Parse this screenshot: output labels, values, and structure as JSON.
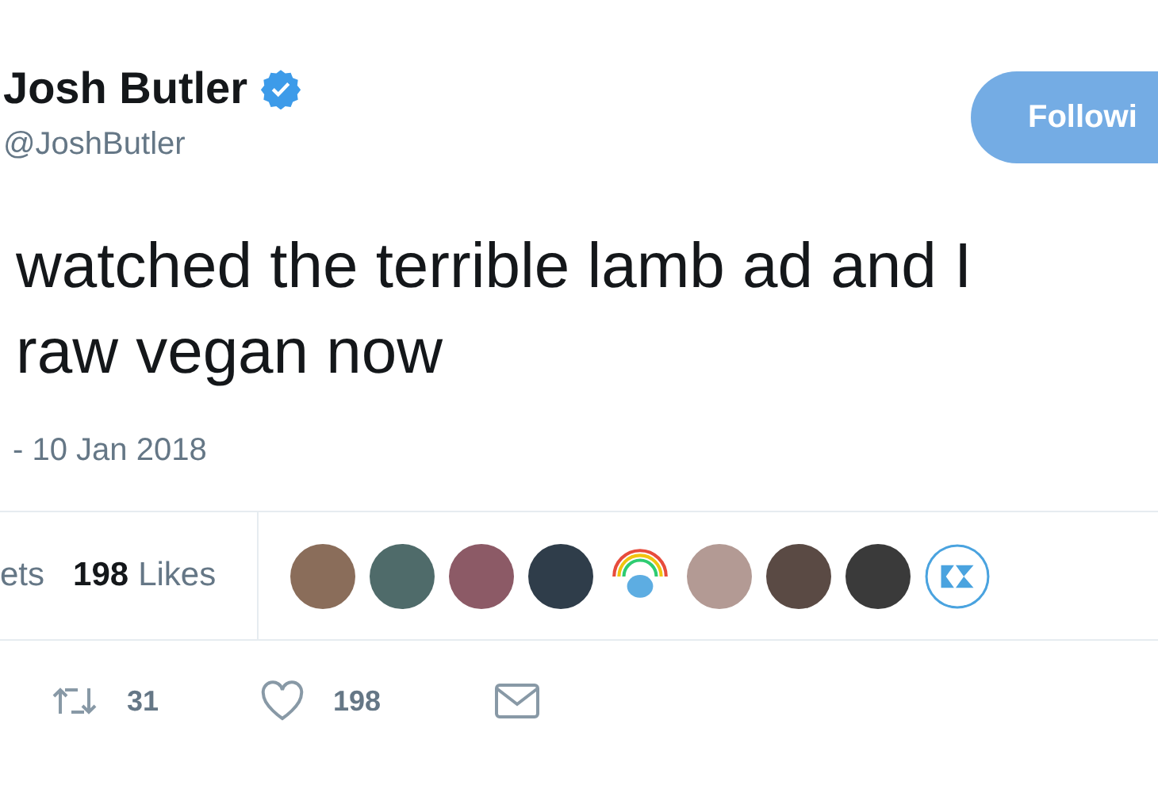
{
  "author": {
    "name": "Josh Butler",
    "verified": true,
    "handle": "@JoshButler"
  },
  "follow_button": {
    "label": "Followi"
  },
  "tweet": {
    "lines": [
      "watched the terrible lamb ad and I",
      "raw vegan now"
    ]
  },
  "timestamp": "- 10 Jan 2018",
  "stats": {
    "retweets_label": "ets",
    "likes_count": "198",
    "likes_label": "Likes"
  },
  "likers": [
    {
      "kind": "photo"
    },
    {
      "kind": "photo"
    },
    {
      "kind": "photo"
    },
    {
      "kind": "photo"
    },
    {
      "kind": "bird"
    },
    {
      "kind": "photo"
    },
    {
      "kind": "photo"
    },
    {
      "kind": "photo"
    },
    {
      "kind": "logo"
    }
  ],
  "actions": {
    "retweets": "31",
    "likes": "198"
  }
}
